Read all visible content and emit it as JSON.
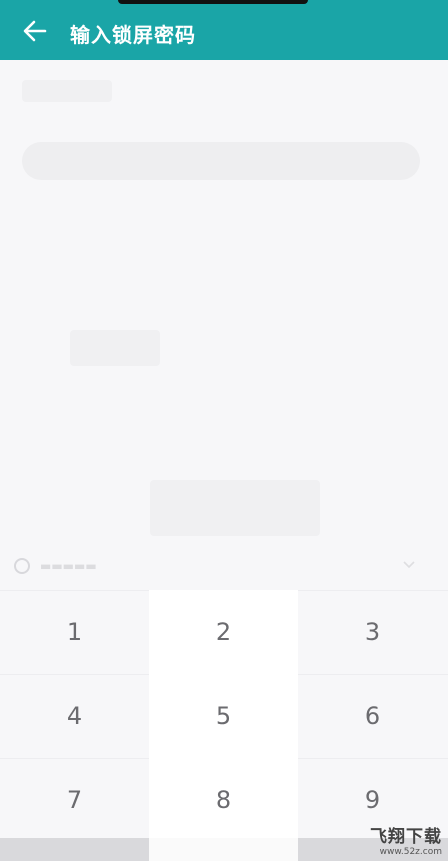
{
  "header": {
    "title": "输入锁屏密码",
    "back_icon": "arrow-left-icon",
    "color": "#1aa5a7"
  },
  "keypad": {
    "keys": [
      "1",
      "2",
      "3",
      "4",
      "5",
      "6",
      "7",
      "8",
      "9"
    ]
  },
  "watermark": {
    "title": "飞翔下载",
    "url": "www.52z.com"
  }
}
